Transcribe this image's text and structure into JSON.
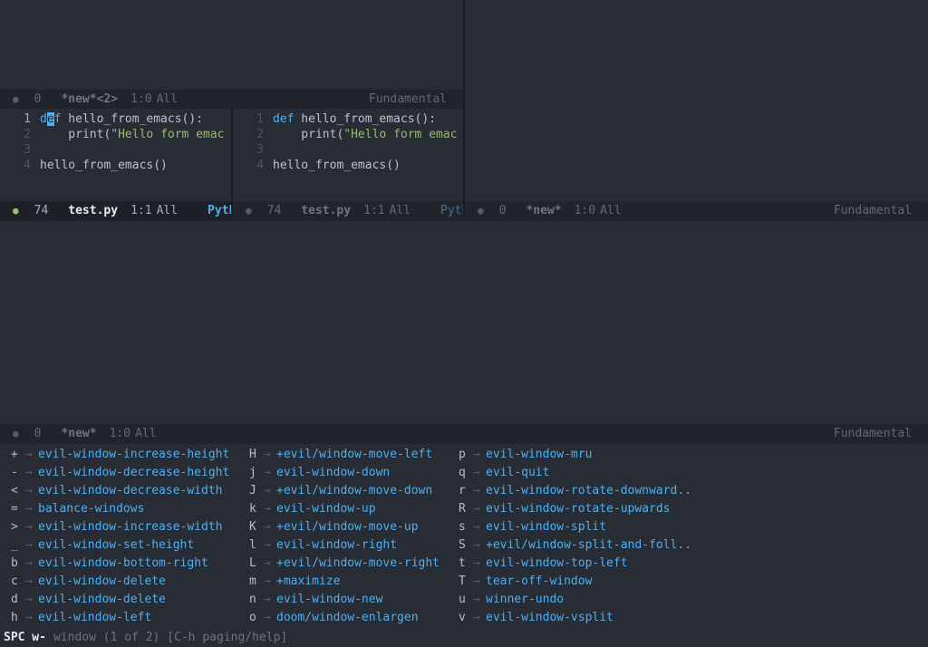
{
  "theme": {
    "bg": "#282c34",
    "modeline_bg": "#21242b",
    "modeline_bg_active": "#1d2026",
    "fg": "#bbc2cf",
    "dim": "#5b6268",
    "blue": "#51afef",
    "green": "#98be65",
    "divider": "#191c21"
  },
  "code": {
    "windows": [
      {
        "id": "left",
        "lines": [
          {
            "num": "1",
            "current": true,
            "tokens": [
              {
                "t": "d",
                "c": "kw"
              },
              {
                "t": "e",
                "c": "cur"
              },
              {
                "t": "f",
                "c": "kw"
              },
              {
                "t": " hello_from_emacs():",
                "c": "def"
              }
            ]
          },
          {
            "num": "2",
            "tokens": [
              {
                "t": "    print(",
                "c": "def"
              },
              {
                "t": "\"Hello form emac",
                "c": "str"
              }
            ]
          },
          {
            "num": "3",
            "tokens": []
          },
          {
            "num": "4",
            "tokens": [
              {
                "t": "hello_from_emacs()",
                "c": "def"
              }
            ]
          }
        ]
      },
      {
        "id": "right",
        "lines": [
          {
            "num": "1",
            "tokens": [
              {
                "t": "def",
                "c": "kw"
              },
              {
                "t": " hello_from_emacs():",
                "c": "def"
              }
            ]
          },
          {
            "num": "2",
            "tokens": [
              {
                "t": "    print(",
                "c": "def"
              },
              {
                "t": "\"Hello form emac",
                "c": "str"
              }
            ]
          },
          {
            "num": "3",
            "tokens": []
          },
          {
            "num": "4",
            "tokens": [
              {
                "t": "hello_from_emacs()",
                "c": "def"
              }
            ]
          }
        ]
      }
    ]
  },
  "modelines": {
    "top": {
      "dot": "●",
      "size": "0",
      "buffer": "*new*<2>",
      "pos": "1:0",
      "scroll": "All",
      "mode": "Fundamental"
    },
    "code_left": {
      "dot": "●",
      "size": "74",
      "buffer": "test.py",
      "pos": "1:1",
      "scroll": "All",
      "mode": "Python"
    },
    "code_mid": {
      "dot": "●",
      "size": "74",
      "buffer": "test.py",
      "pos": "1:1",
      "scroll": "All",
      "mode": "Python"
    },
    "right": {
      "dot": "●",
      "size": "0",
      "buffer": "*new*",
      "pos": "1:0",
      "scroll": "All",
      "mode": "Fundamental"
    },
    "bottom": {
      "dot": "●",
      "size": "0",
      "buffer": "*new*",
      "pos": "1:0",
      "scroll": "All",
      "mode": "Fundamental"
    }
  },
  "which_key": {
    "arrow": "→",
    "columns": [
      {
        "bindings": [
          {
            "key": "+",
            "cmd": "evil-window-increase-height"
          },
          {
            "key": "-",
            "cmd": "evil-window-decrease-height"
          },
          {
            "key": "<",
            "cmd": "evil-window-decrease-width"
          },
          {
            "key": "=",
            "cmd": "balance-windows"
          },
          {
            "key": ">",
            "cmd": "evil-window-increase-width"
          },
          {
            "key": "_",
            "cmd": "evil-window-set-height"
          },
          {
            "key": "b",
            "cmd": "evil-window-bottom-right"
          },
          {
            "key": "c",
            "cmd": "evil-window-delete"
          },
          {
            "key": "d",
            "cmd": "evil-window-delete"
          },
          {
            "key": "h",
            "cmd": "evil-window-left"
          }
        ]
      },
      {
        "bindings": [
          {
            "key": "H",
            "cmd": "+evil/window-move-left"
          },
          {
            "key": "j",
            "cmd": "evil-window-down"
          },
          {
            "key": "J",
            "cmd": "+evil/window-move-down"
          },
          {
            "key": "k",
            "cmd": "evil-window-up"
          },
          {
            "key": "K",
            "cmd": "+evil/window-move-up"
          },
          {
            "key": "l",
            "cmd": "evil-window-right"
          },
          {
            "key": "L",
            "cmd": "+evil/window-move-right"
          },
          {
            "key": "m",
            "cmd": "+maximize"
          },
          {
            "key": "n",
            "cmd": "evil-window-new"
          },
          {
            "key": "o",
            "cmd": "doom/window-enlargen"
          }
        ]
      },
      {
        "bindings": [
          {
            "key": "p",
            "cmd": "evil-window-mru"
          },
          {
            "key": "q",
            "cmd": "evil-quit"
          },
          {
            "key": "r",
            "cmd": "evil-window-rotate-downward.."
          },
          {
            "key": "R",
            "cmd": "evil-window-rotate-upwards"
          },
          {
            "key": "s",
            "cmd": "evil-window-split"
          },
          {
            "key": "S",
            "cmd": "+evil/window-split-and-foll.."
          },
          {
            "key": "t",
            "cmd": "evil-window-top-left"
          },
          {
            "key": "T",
            "cmd": "tear-off-window"
          },
          {
            "key": "u",
            "cmd": "winner-undo"
          },
          {
            "key": "v",
            "cmd": "evil-window-vsplit"
          }
        ]
      }
    ]
  },
  "echo": {
    "prefix": "SPC w-",
    "message": "window (1 of 2) [C-h paging/help]"
  }
}
